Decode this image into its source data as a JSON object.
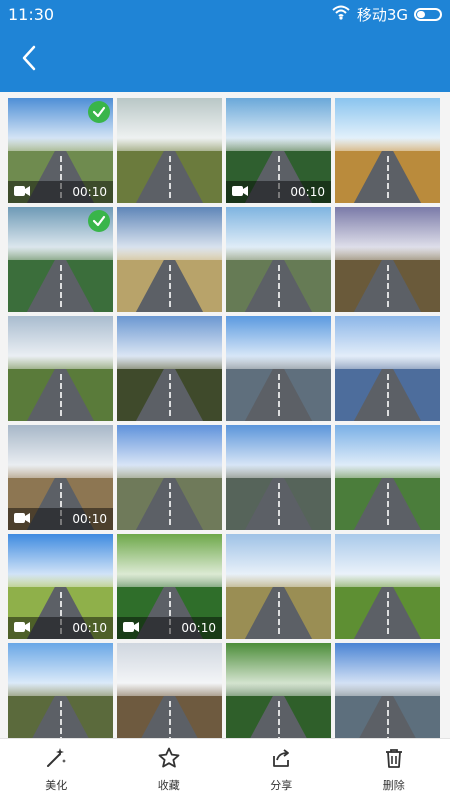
{
  "statusbar": {
    "time": "11:30",
    "network": "移动3G"
  },
  "toolbar": {
    "items": [
      {
        "label": "美化",
        "icon": "magic-wand-icon"
      },
      {
        "label": "收藏",
        "icon": "star-icon"
      },
      {
        "label": "分享",
        "icon": "share-icon"
      },
      {
        "label": "删除",
        "icon": "trash-icon"
      }
    ]
  },
  "grid": {
    "items": [
      {
        "type": "video",
        "duration": "00:10",
        "selected": true,
        "sky": "#4e8fd6",
        "ground": "#6f8b4f"
      },
      {
        "type": "image",
        "duration": "",
        "selected": false,
        "sky": "#b9c7c6",
        "ground": "#6b7b3d"
      },
      {
        "type": "video",
        "duration": "00:10",
        "selected": false,
        "sky": "#6aa8d9",
        "ground": "#2f5f2f"
      },
      {
        "type": "image",
        "duration": "",
        "selected": false,
        "sky": "#8ac4ef",
        "ground": "#ba8b3c"
      },
      {
        "type": "image",
        "duration": "",
        "selected": true,
        "sky": "#6e9ab6",
        "ground": "#3b6e3b"
      },
      {
        "type": "image",
        "duration": "",
        "selected": false,
        "sky": "#5f86b8",
        "ground": "#b8a36a"
      },
      {
        "type": "image",
        "duration": "",
        "selected": false,
        "sky": "#7fb4e0",
        "ground": "#667b55"
      },
      {
        "type": "image",
        "duration": "",
        "selected": false,
        "sky": "#7a7aa8",
        "ground": "#6a5a3a"
      },
      {
        "type": "image",
        "duration": "",
        "selected": false,
        "sky": "#a9bccf",
        "ground": "#5a7b3a"
      },
      {
        "type": "image",
        "duration": "",
        "selected": false,
        "sky": "#6b97d1",
        "ground": "#3f4a2b"
      },
      {
        "type": "image",
        "duration": "",
        "selected": false,
        "sky": "#5b9ae0",
        "ground": "#5f6f7d"
      },
      {
        "type": "image",
        "duration": "",
        "selected": false,
        "sky": "#8cb6e8",
        "ground": "#4d6d9c"
      },
      {
        "type": "video",
        "duration": "00:10",
        "selected": false,
        "sky": "#a7b7c8",
        "ground": "#8d7652"
      },
      {
        "type": "image",
        "duration": "",
        "selected": false,
        "sky": "#5f92db",
        "ground": "#6f7a5a"
      },
      {
        "type": "image",
        "duration": "",
        "selected": false,
        "sky": "#5b95da",
        "ground": "#56645a"
      },
      {
        "type": "image",
        "duration": "",
        "selected": false,
        "sky": "#7ab0e6",
        "ground": "#4b7d3b"
      },
      {
        "type": "video",
        "duration": "00:10",
        "selected": false,
        "sky": "#3f8be0",
        "ground": "#8fb04a"
      },
      {
        "type": "video",
        "duration": "00:10",
        "selected": false,
        "sky": "#6ea84a",
        "ground": "#2f6e2a"
      },
      {
        "type": "image",
        "duration": "",
        "selected": false,
        "sky": "#9fc2e6",
        "ground": "#9a8e54"
      },
      {
        "type": "image",
        "duration": "",
        "selected": false,
        "sky": "#a9c9ea",
        "ground": "#5e8f33"
      },
      {
        "type": "image",
        "duration": "",
        "selected": false,
        "sky": "#6aa7e6",
        "ground": "#5b6a3c"
      },
      {
        "type": "image",
        "duration": "",
        "selected": false,
        "sky": "#cfd6df",
        "ground": "#6e5a3f"
      },
      {
        "type": "image",
        "duration": "",
        "selected": false,
        "sky": "#4c8d39",
        "ground": "#2f5f2a"
      },
      {
        "type": "image",
        "duration": "",
        "selected": false,
        "sky": "#4a84d4",
        "ground": "#5d6f7d"
      }
    ]
  },
  "colors": {
    "primary": "#1f84d6",
    "check": "#39b54a"
  }
}
